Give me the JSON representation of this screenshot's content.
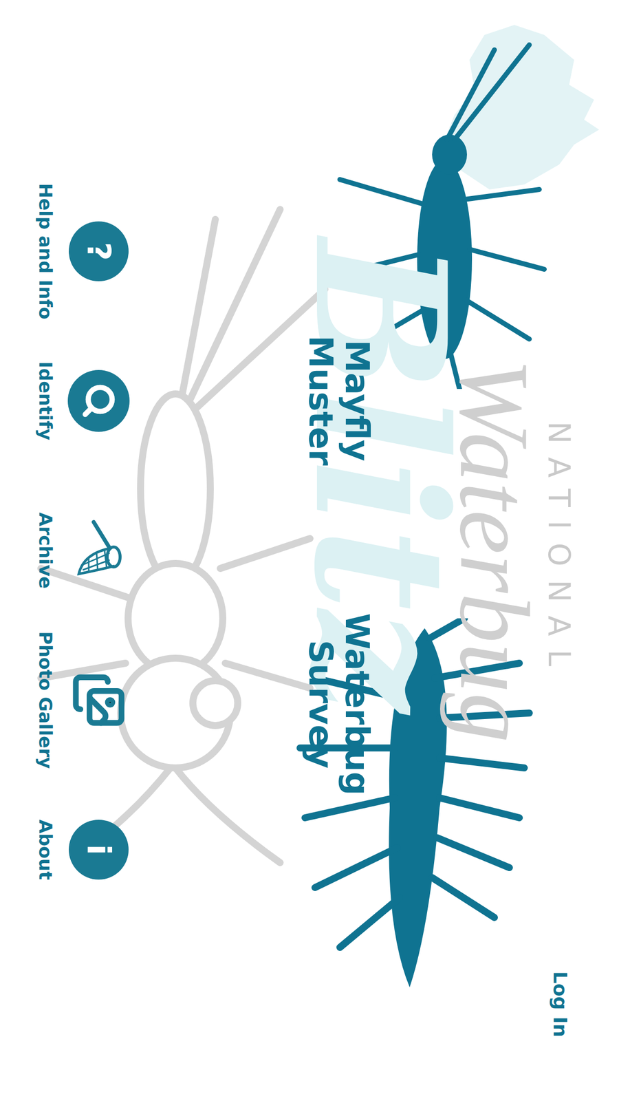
{
  "header": {
    "title_prefix": "NATIONAL",
    "title": "Waterbug",
    "title_suffix": "Blitz",
    "login": "Log In"
  },
  "actions": [
    {
      "label": "Mayfly Muster"
    },
    {
      "label": "Waterbug Survey"
    }
  ],
  "nav": [
    {
      "label": "Help and Info",
      "kind": "circle-glyph",
      "glyph": "?"
    },
    {
      "label": "Identify",
      "kind": "circle-search"
    },
    {
      "label": "Archive",
      "kind": "net"
    },
    {
      "label": "Photo Gallery",
      "kind": "gallery"
    },
    {
      "label": "About",
      "kind": "circle-glyph",
      "glyph": "i"
    }
  ]
}
